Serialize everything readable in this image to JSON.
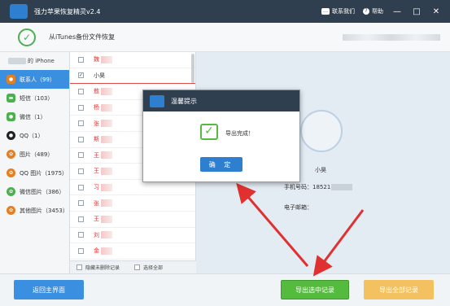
{
  "titlebar": {
    "title": "强力苹果恢复精灵v2.4",
    "contact": "联系我们",
    "help": "帮助",
    "minimize": "—",
    "maximize": "□",
    "close": "✕"
  },
  "header": {
    "title": "从iTunes备份文件恢复"
  },
  "sidebar": {
    "device": "的 iPhone",
    "items": [
      {
        "label": "联系人（99）",
        "icon": "contacts-icon",
        "color": "#e67e22"
      },
      {
        "label": "短信（103）",
        "icon": "sms-icon",
        "color": "#4caf50"
      },
      {
        "label": "微信（1）",
        "icon": "wechat-icon",
        "color": "#4caf50"
      },
      {
        "label": "QQ（1）",
        "icon": "qq-icon",
        "color": "#222222"
      },
      {
        "label": "图片（489）",
        "icon": "photos-icon",
        "color": "#e67e22"
      },
      {
        "label": "QQ 图片（1975）",
        "icon": "qq-photos-icon",
        "color": "#e67e22"
      },
      {
        "label": "微信图片（386）",
        "icon": "wechat-photos-icon",
        "color": "#4caf50"
      },
      {
        "label": "其他图片（3453）",
        "icon": "other-photos-icon",
        "color": "#e67e22"
      }
    ]
  },
  "list": {
    "rows": [
      {
        "name": "魏",
        "checked": false
      },
      {
        "name": "小昊",
        "checked": true
      },
      {
        "name": "敖",
        "checked": false
      },
      {
        "name": "杨",
        "checked": false
      },
      {
        "name": "张",
        "checked": false
      },
      {
        "name": "斯",
        "checked": false
      },
      {
        "name": "王",
        "checked": false
      },
      {
        "name": "王",
        "checked": false
      },
      {
        "name": "习",
        "checked": false
      },
      {
        "name": "张",
        "checked": false
      },
      {
        "name": "王",
        "checked": false
      },
      {
        "name": "刘",
        "checked": false
      },
      {
        "name": "金",
        "checked": false
      },
      {
        "name": "刘",
        "checked": false
      }
    ],
    "hide_unselected": "隐藏未删除记录",
    "select_all": "选择全部"
  },
  "detail": {
    "name": "小昊",
    "phone_label": "手机号码：18521",
    "email_label": "电子邮箱："
  },
  "footer": {
    "back": "返回主界面",
    "export_selected": "导出选中记录",
    "export_all": "导出全部记录"
  },
  "dialog": {
    "title": "温馨提示",
    "message": "导出完成！",
    "ok": "确 定"
  }
}
